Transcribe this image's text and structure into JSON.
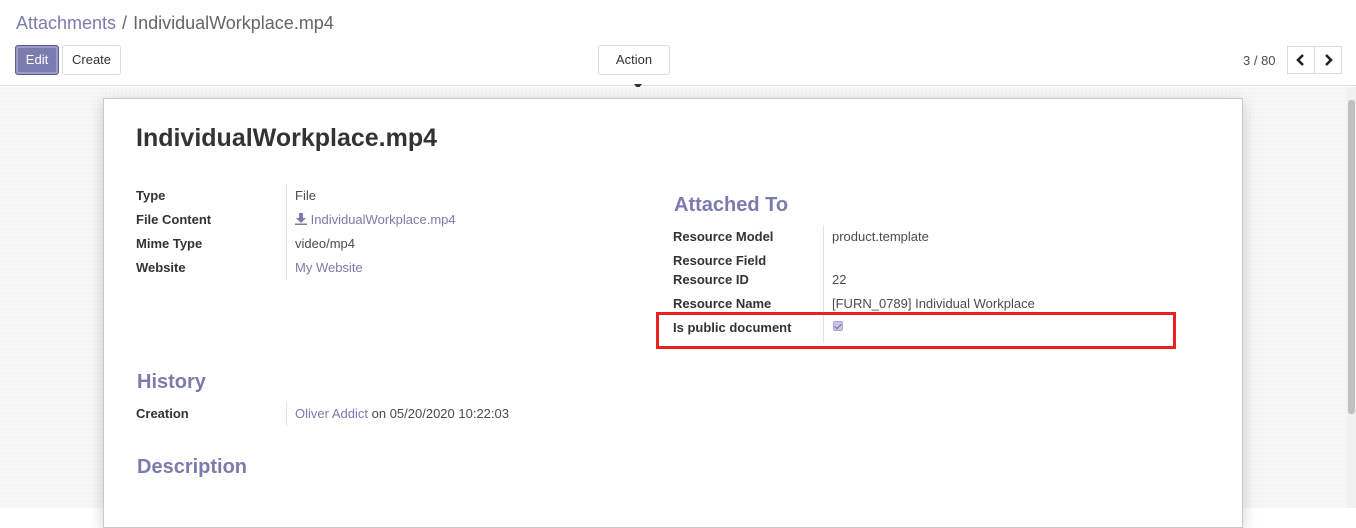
{
  "breadcrumb": {
    "parent": "Attachments",
    "separator": "/",
    "current": "IndividualWorkplace.mp4"
  },
  "toolbar": {
    "edit_label": "Edit",
    "create_label": "Create",
    "action_label": "Action"
  },
  "pager": {
    "value": "3 / 80"
  },
  "record": {
    "name": "IndividualWorkplace.mp4",
    "fields": {
      "type": {
        "label": "Type",
        "value": "File"
      },
      "file_content": {
        "label": "File Content",
        "value": "IndividualWorkplace.mp4",
        "icon": "download-icon"
      },
      "mime_type": {
        "label": "Mime Type",
        "value": "video/mp4"
      },
      "website": {
        "label": "Website",
        "value": "My Website"
      }
    },
    "attached_to": {
      "heading": "Attached To",
      "resource_model": {
        "label": "Resource Model",
        "value": "product.template"
      },
      "resource_field": {
        "label": "Resource Field",
        "value": ""
      },
      "resource_id": {
        "label": "Resource ID",
        "value": "22"
      },
      "resource_name": {
        "label": "Resource Name",
        "value": "[FURN_0789] Individual Workplace"
      },
      "is_public": {
        "label": "Is public document",
        "checked": true
      }
    },
    "history": {
      "heading": "History",
      "creation": {
        "label": "Creation",
        "user": "Oliver Addict",
        "connector": "on",
        "date": "05/20/2020 10:22:03"
      }
    },
    "description": {
      "heading": "Description"
    }
  },
  "colors": {
    "accent": "#7c7bad",
    "highlight": "#e8231f"
  }
}
